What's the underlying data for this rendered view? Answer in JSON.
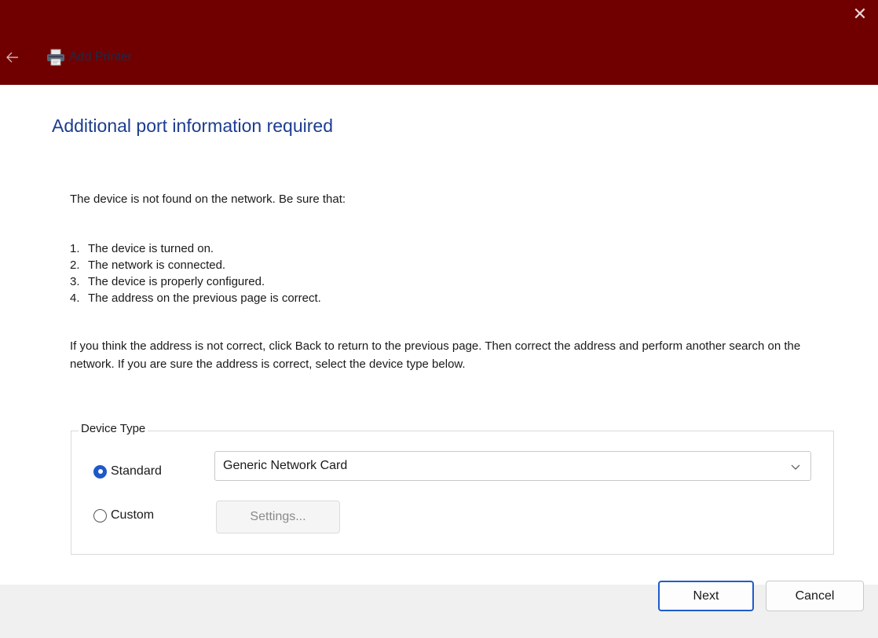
{
  "window": {
    "title": "Add Printer",
    "close_glyph": "✕",
    "back_glyph": "←",
    "accent_color": "#700000"
  },
  "page": {
    "heading": "Additional port information required",
    "intro": "The device is not found on the network.  Be sure that:",
    "checklist": [
      {
        "num": "1.",
        "text": "The device is turned on."
      },
      {
        "num": "2.",
        "text": "The network is connected."
      },
      {
        "num": "3.",
        "text": "The device is properly configured."
      },
      {
        "num": "4.",
        "text": "The address on the previous page is correct."
      }
    ],
    "explanation": "If you think the address is not correct, click Back to return to the previous page.  Then correct the address and perform another search on the network.  If you are sure the address is correct, select the device type below."
  },
  "device_type": {
    "legend": "Device Type",
    "standard_label": "Standard",
    "custom_label": "Custom",
    "selected": "standard",
    "standard_value": "Generic Network Card",
    "settings_label": "Settings..."
  },
  "footer": {
    "next_label": "Next",
    "cancel_label": "Cancel"
  }
}
